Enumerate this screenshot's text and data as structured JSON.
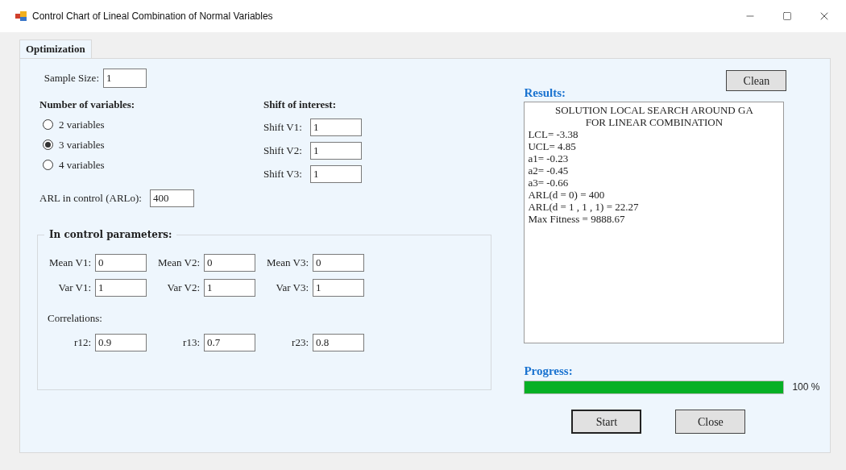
{
  "window": {
    "title": "Control Chart of Lineal Combination of Normal Variables"
  },
  "tabs": [
    {
      "label": "Optimization",
      "selected": true
    }
  ],
  "sample_size": {
    "label": "Sample Size:",
    "value": "1"
  },
  "variables": {
    "title": "Number of variables:",
    "options": [
      {
        "label": "2 variables",
        "selected": false
      },
      {
        "label": "3 variables",
        "selected": true
      },
      {
        "label": "4 variables",
        "selected": false
      }
    ]
  },
  "shift": {
    "title": "Shift of interest:",
    "fields": [
      {
        "label": "Shift V1:",
        "value": "1"
      },
      {
        "label": "Shift V2:",
        "value": "1"
      },
      {
        "label": "Shift V3:",
        "value": "1"
      }
    ]
  },
  "arl": {
    "label": "ARL in control (ARLo):",
    "value": "400"
  },
  "parameters": {
    "title": "In control parameters:",
    "means": [
      {
        "label": "Mean V1:",
        "value": "0"
      },
      {
        "label": "Mean V2:",
        "value": "0"
      },
      {
        "label": "Mean V3:",
        "value": "0"
      }
    ],
    "variances": [
      {
        "label": "Var V1:",
        "value": "1"
      },
      {
        "label": "Var V2:",
        "value": "1"
      },
      {
        "label": "Var V3:",
        "value": "1"
      }
    ],
    "correlations_label": "Correlations:",
    "correlations": [
      {
        "label": "r12:",
        "value": "0.9"
      },
      {
        "label": "r13:",
        "value": "0.7"
      },
      {
        "label": "r23:",
        "value": "0.8"
      }
    ]
  },
  "clean_button": "Clean",
  "results": {
    "label": "Results:",
    "heading": [
      "SOLUTION LOCAL SEARCH AROUND GA",
      "FOR LINEAR COMBINATION"
    ],
    "lines": [
      "LCL= -3.38",
      "UCL= 4.85",
      "a1= -0.23",
      "a2= -0.45",
      "a3= -0.66",
      "ARL(d = 0) = 400",
      "ARL(d = 1 , 1 , 1) = 22.27",
      "Max Fitness = 9888.67"
    ]
  },
  "progress": {
    "label": "Progress:",
    "level": 1,
    "reading": "100 %"
  },
  "buttons": [
    "Start",
    "Close"
  ]
}
